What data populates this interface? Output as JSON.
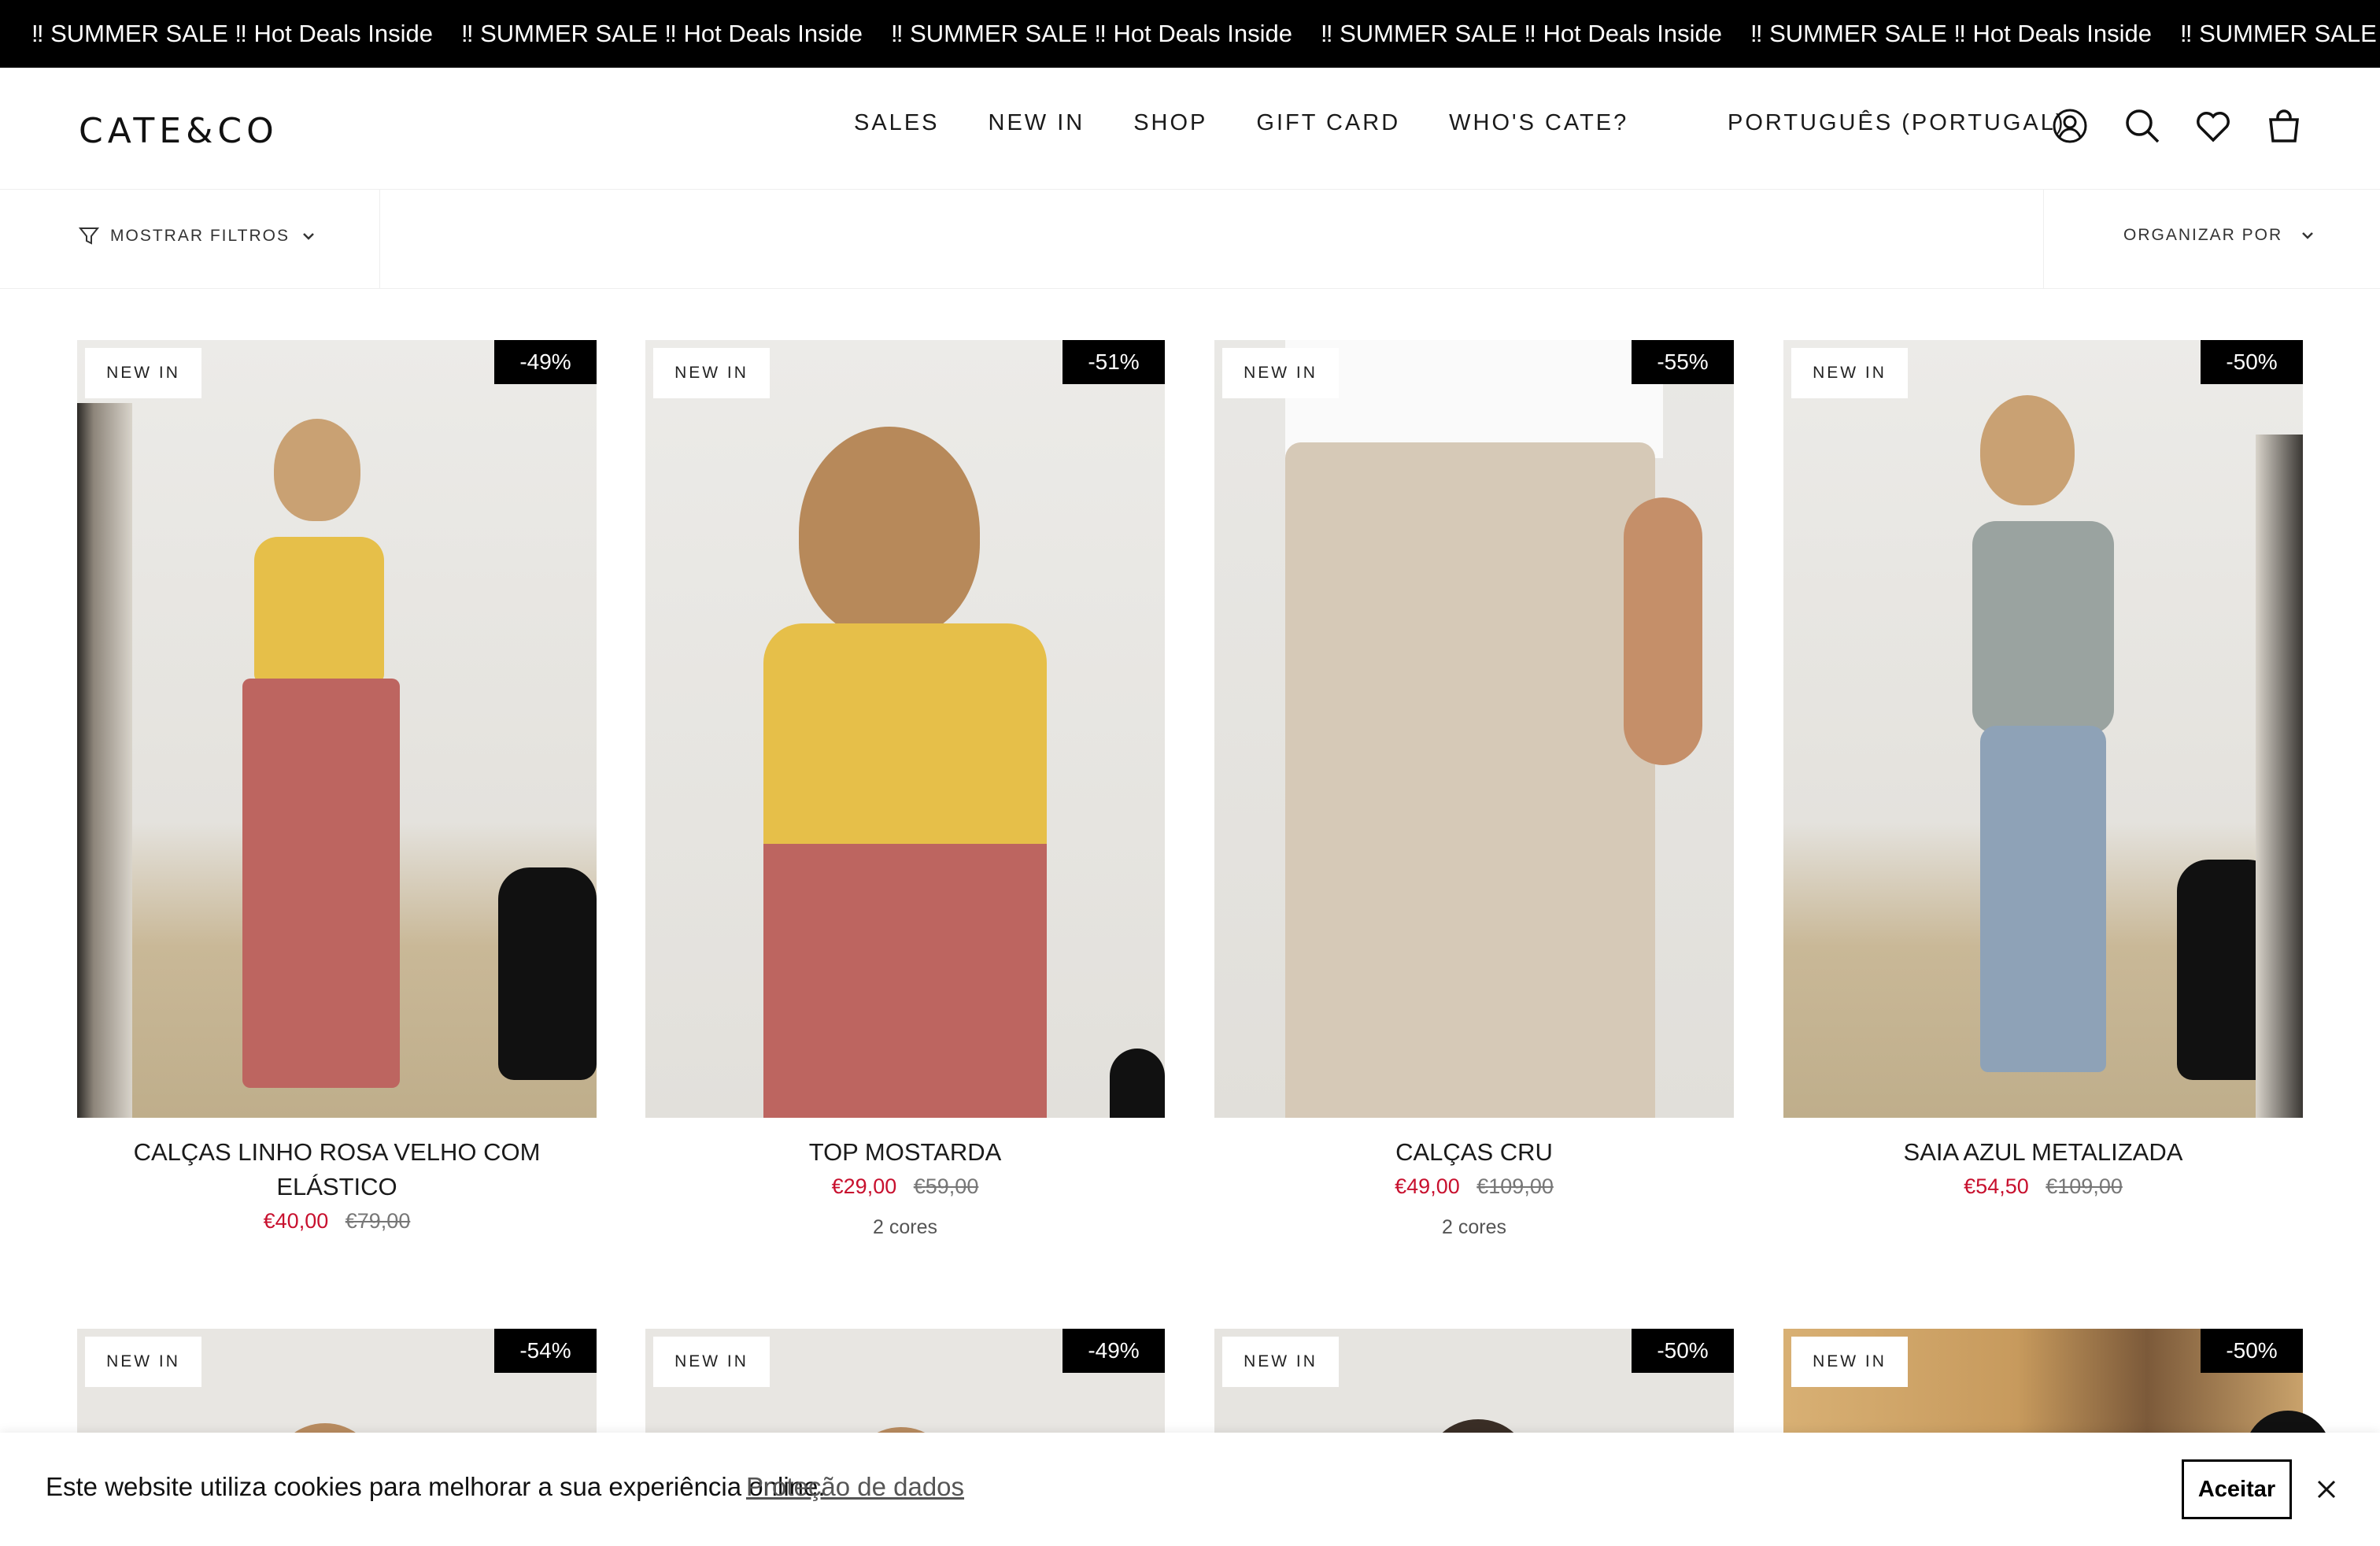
{
  "announcement": {
    "items": [
      "‼ SUMMER SALE ‼ Hot Deals Inside",
      "‼ SUMMER SALE ‼ Hot Deals Inside",
      "‼ SUMMER SALE ‼ Hot Deals Inside",
      "‼ SUMMER SALE ‼ Hot Deals Inside",
      "‼ SUMMER SALE ‼ Hot Deals Inside",
      "‼ SUMMER SALE ‼ Hot Deals Inside"
    ]
  },
  "header": {
    "logo": "CATE&CO",
    "nav": [
      "SALES",
      "NEW IN",
      "SHOP",
      "GIFT CARD",
      "WHO'S CATE?"
    ],
    "language": "PORTUGUÊS (PORTUGAL)",
    "icons": [
      "account-icon",
      "search-icon",
      "heart-icon",
      "bag-icon"
    ]
  },
  "filters": {
    "show_filters": "MOSTRAR FILTROS",
    "sort_by": "ORGANIZAR POR"
  },
  "products": [
    {
      "badge": "NEW IN",
      "discount": "-49%",
      "title": "CALÇAS LINHO ROSA VELHO COM ELÁSTICO",
      "price": "€40,00",
      "old_price": "€79,00",
      "colors": ""
    },
    {
      "badge": "NEW IN",
      "discount": "-51%",
      "title": "TOP MOSTARDA",
      "price": "€29,00",
      "old_price": "€59,00",
      "colors": "2 cores"
    },
    {
      "badge": "NEW IN",
      "discount": "-55%",
      "title": "CALÇAS CRU",
      "price": "€49,00",
      "old_price": "€109,00",
      "colors": "2 cores"
    },
    {
      "badge": "NEW IN",
      "discount": "-50%",
      "title": "SAIA AZUL METALIZADA",
      "price": "€54,50",
      "old_price": "€109,00",
      "colors": ""
    },
    {
      "badge": "NEW IN",
      "discount": "-54%"
    },
    {
      "badge": "NEW IN",
      "discount": "-49%"
    },
    {
      "badge": "NEW IN",
      "discount": "-50%"
    },
    {
      "badge": "NEW IN",
      "discount": "-50%"
    }
  ],
  "cookie": {
    "text": "Este website utiliza cookies para melhorar a sua experiência online.",
    "link": "Proteção de dados",
    "accept": "Aceitar"
  },
  "colors": {
    "sale_red": "#c8102e",
    "bar_black": "#000000"
  }
}
